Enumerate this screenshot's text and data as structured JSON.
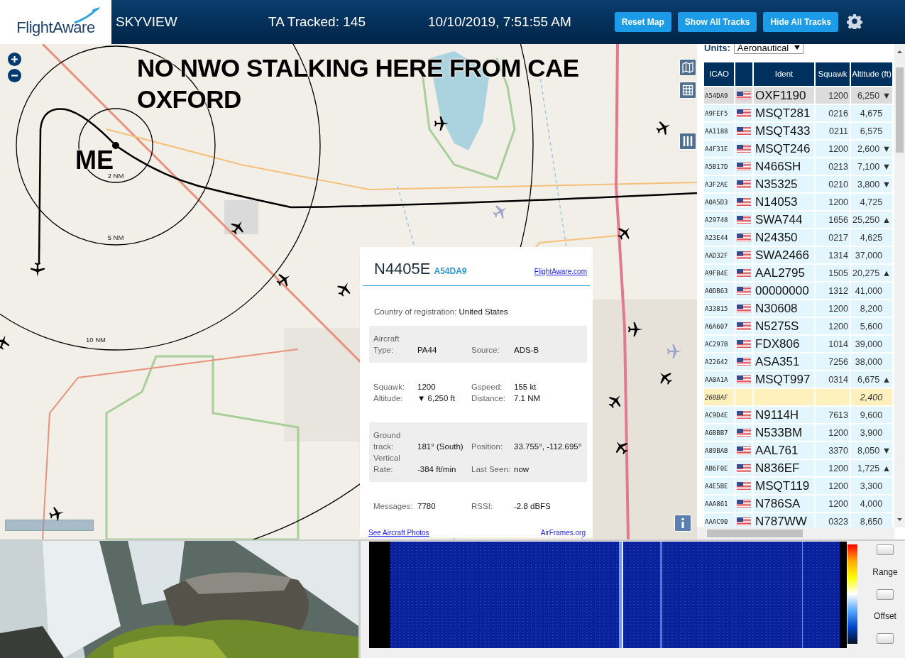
{
  "header": {
    "logo": "FlightAware",
    "title": "SKYVIEW",
    "tracked": "TA Tracked: 145",
    "datetime": "10/10/2019, 7:51:55 AM",
    "buttons": [
      "Reset Map",
      "Show All Tracks",
      "Hide All Tracks"
    ]
  },
  "map": {
    "annotations": [
      {
        "kind": "banner",
        "text": "NO NWO STALKING HERE FROM CAE OXFORD"
      },
      {
        "kind": "marker",
        "text": "ME"
      }
    ],
    "range_rings": [
      "2 NM",
      "5 NM",
      "10 NM"
    ],
    "popup": {
      "ident": "N4405E",
      "hex": "A54DA9",
      "link": "FlightAware.com",
      "country_label": "Country of registration:",
      "country": "United States",
      "sections": [
        {
          "shaded": true,
          "fields": [
            {
              "label": "Aircraft Type:",
              "value": "PA44"
            },
            {
              "label": "Source:",
              "value": "ADS-B"
            }
          ]
        },
        {
          "shaded": false,
          "fields": [
            {
              "label": "Squawk:",
              "value": "1200"
            },
            {
              "label": "Gspeed:",
              "value": "155 kt"
            },
            {
              "label": "Altitude:",
              "value": "▼ 6,250 ft"
            },
            {
              "label": "Distance:",
              "value": "7.1 NM"
            }
          ]
        },
        {
          "shaded": true,
          "fields": [
            {
              "label": "Ground track:",
              "value": "181° (South)"
            },
            {
              "label": "Position:",
              "value": "33.755°, -112.695°"
            },
            {
              "label": "Vertical Rate:",
              "value": "-384 ft/min"
            },
            {
              "label": "Last Seen:",
              "value": "now"
            }
          ]
        },
        {
          "shaded": false,
          "fields": [
            {
              "label": "Messages:",
              "value": "7780"
            },
            {
              "label": "RSSI:",
              "value": "-2.8 dBFS"
            }
          ]
        }
      ],
      "photos_link": "See Aircraft Photos",
      "airframes_link": "AirFrames.org"
    }
  },
  "units": {
    "label": "Units:",
    "value": "Aeronautical"
  },
  "table": {
    "columns": [
      "ICAO",
      "Ident",
      "Squawk",
      "Altitude (ft)"
    ],
    "rows": [
      {
        "icao": "A54DA9",
        "flag": true,
        "ident": "OXF1190",
        "squawk": "1200",
        "altitude": "6,250",
        "trend": "▼",
        "selected": true,
        "highlighted": false
      },
      {
        "icao": "A9FEF5",
        "flag": true,
        "ident": "MSQT281",
        "squawk": "0216",
        "altitude": "4,675",
        "selected": false,
        "highlighted": false
      },
      {
        "icao": "AA1188",
        "flag": true,
        "ident": "MSQT433",
        "squawk": "0211",
        "altitude": "6,575",
        "selected": false,
        "highlighted": false
      },
      {
        "icao": "A4F31E",
        "flag": true,
        "ident": "MSQT246",
        "squawk": "1200",
        "altitude": "2,600",
        "trend": "▼",
        "selected": false,
        "highlighted": false
      },
      {
        "icao": "A5B17D",
        "flag": true,
        "ident": "N466SH",
        "squawk": "0213",
        "altitude": "7,100",
        "trend": "▼",
        "selected": false,
        "highlighted": false
      },
      {
        "icao": "A3F2AE",
        "flag": true,
        "ident": "N35325",
        "squawk": "0210",
        "altitude": "3,800",
        "trend": "▼",
        "selected": false,
        "highlighted": false
      },
      {
        "icao": "A0A5D3",
        "flag": true,
        "ident": "N14053",
        "squawk": "1200",
        "altitude": "4,725",
        "selected": false,
        "highlighted": false
      },
      {
        "icao": "A29748",
        "flag": true,
        "ident": "SWA744",
        "squawk": "1656",
        "altitude": "25,250",
        "trend": "▲",
        "selected": false,
        "highlighted": false
      },
      {
        "icao": "A23E44",
        "flag": true,
        "ident": "N24350",
        "squawk": "0217",
        "altitude": "4,625",
        "selected": false,
        "highlighted": false
      },
      {
        "icao": "AAD32F",
        "flag": true,
        "ident": "SWA2466",
        "squawk": "1314",
        "altitude": "37,000",
        "selected": false,
        "highlighted": false
      },
      {
        "icao": "A9FB4E",
        "flag": true,
        "ident": "AAL2795",
        "squawk": "1505",
        "altitude": "20,275",
        "trend": "▲",
        "selected": false,
        "highlighted": false
      },
      {
        "icao": "A0DB63",
        "flag": true,
        "ident": "00000000",
        "squawk": "1312",
        "altitude": "41,000",
        "selected": false,
        "highlighted": false
      },
      {
        "icao": "A33815",
        "flag": true,
        "ident": "N30608",
        "squawk": "1200",
        "altitude": "8,200",
        "selected": false,
        "highlighted": false
      },
      {
        "icao": "A6A607",
        "flag": true,
        "ident": "N5275S",
        "squawk": "1200",
        "altitude": "5,600",
        "selected": false,
        "highlighted": false
      },
      {
        "icao": "AC297B",
        "flag": true,
        "ident": "FDX806",
        "squawk": "1014",
        "altitude": "39,000",
        "selected": false,
        "highlighted": false
      },
      {
        "icao": "A22642",
        "flag": true,
        "ident": "ASA351",
        "squawk": "7256",
        "altitude": "38,000",
        "selected": false,
        "highlighted": false
      },
      {
        "icao": "AA0A1A",
        "flag": true,
        "ident": "MSQT997",
        "squawk": "0314",
        "altitude": "6,675",
        "trend": "▲",
        "selected": false,
        "highlighted": false
      },
      {
        "icao": "268BAF",
        "flag": false,
        "altitude": "2,400",
        "selected": false,
        "highlighted": true
      },
      {
        "icao": "AC9D4E",
        "flag": true,
        "ident": "N9114H",
        "squawk": "7613",
        "altitude": "9,600",
        "selected": false,
        "highlighted": false
      },
      {
        "icao": "A6BBB7",
        "flag": true,
        "ident": "N533BM",
        "squawk": "1200",
        "altitude": "3,900",
        "selected": false,
        "highlighted": false
      },
      {
        "icao": "A89BAB",
        "flag": true,
        "ident": "AAL761",
        "squawk": "3370",
        "altitude": "8,050",
        "trend": "▼",
        "selected": false,
        "highlighted": false
      },
      {
        "icao": "AB6F0E",
        "flag": true,
        "ident": "N836EF",
        "squawk": "1200",
        "altitude": "1,725",
        "trend": "▲",
        "selected": false,
        "highlighted": false
      },
      {
        "icao": "A4E5BE",
        "flag": true,
        "ident": "MSQT119",
        "squawk": "1200",
        "altitude": "3,300",
        "selected": false,
        "highlighted": false
      },
      {
        "icao": "AAA861",
        "flag": true,
        "ident": "N786SA",
        "squawk": "1200",
        "altitude": "4,000",
        "selected": false,
        "highlighted": false
      },
      {
        "icao": "AAAC90",
        "flag": true,
        "ident": "N787WW",
        "squawk": "0323",
        "altitude": "8,650",
        "selected": false,
        "highlighted": false
      }
    ]
  },
  "spectrum": {
    "labels": [
      "Range",
      "Offset"
    ]
  }
}
